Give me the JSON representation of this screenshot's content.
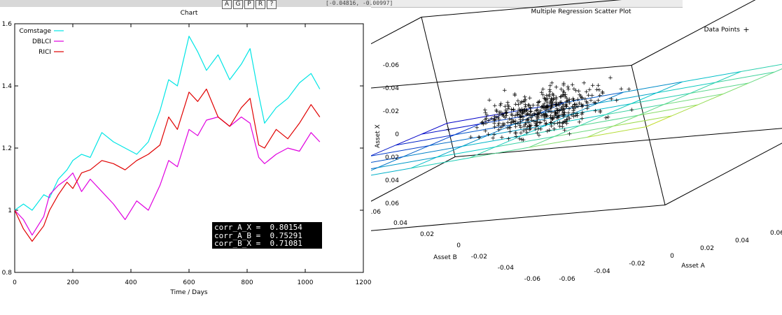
{
  "toolbar": {
    "buttons": [
      "A",
      "G",
      "P",
      "R",
      "?"
    ],
    "coord_readout": "[-0.04816, -0.00997]"
  },
  "left_panel": {
    "title": "Chart",
    "correlations": [
      {
        "label": "corr_A_X",
        "value": "0.80154"
      },
      {
        "label": "corr_A_B",
        "value": "0.75291"
      },
      {
        "label": "corr_B_X",
        "value": "0.71081"
      }
    ]
  },
  "right_panel": {
    "title": "Multiple Regression Scatter Plot"
  },
  "chart_data": [
    {
      "type": "line",
      "title": "Chart",
      "xlabel": "Time / Days",
      "ylabel": "",
      "xlim": [
        0,
        1200
      ],
      "ylim": [
        0.8,
        1.6
      ],
      "xticks": [
        "0",
        "200",
        "400",
        "600",
        "800",
        "1000",
        "1200"
      ],
      "yticks": [
        "0.8",
        "1",
        "1.2",
        "1.4",
        "1.6"
      ],
      "legend_position": "top-left",
      "grid": false,
      "series": [
        {
          "name": "Comstage",
          "color": "#00e5e5",
          "x": [
            0,
            30,
            60,
            100,
            120,
            150,
            180,
            200,
            230,
            260,
            300,
            340,
            380,
            420,
            460,
            500,
            530,
            560,
            600,
            630,
            660,
            700,
            740,
            780,
            810,
            840,
            860,
            900,
            940,
            980,
            1020,
            1050
          ],
          "y": [
            1.0,
            1.02,
            1.0,
            1.05,
            1.04,
            1.1,
            1.13,
            1.16,
            1.18,
            1.17,
            1.25,
            1.22,
            1.2,
            1.18,
            1.22,
            1.32,
            1.42,
            1.4,
            1.56,
            1.51,
            1.45,
            1.5,
            1.42,
            1.47,
            1.52,
            1.37,
            1.28,
            1.33,
            1.36,
            1.41,
            1.44,
            1.39
          ]
        },
        {
          "name": "DBLCI",
          "color": "#e000e0",
          "x": [
            0,
            30,
            60,
            100,
            120,
            150,
            180,
            200,
            230,
            260,
            300,
            340,
            380,
            420,
            460,
            500,
            530,
            560,
            600,
            630,
            660,
            700,
            740,
            780,
            810,
            840,
            860,
            900,
            940,
            980,
            1020,
            1050
          ],
          "y": [
            1.0,
            0.97,
            0.92,
            0.98,
            1.05,
            1.08,
            1.1,
            1.12,
            1.06,
            1.1,
            1.06,
            1.02,
            0.97,
            1.03,
            1.0,
            1.08,
            1.16,
            1.14,
            1.26,
            1.24,
            1.29,
            1.3,
            1.27,
            1.3,
            1.28,
            1.17,
            1.15,
            1.18,
            1.2,
            1.19,
            1.25,
            1.22
          ]
        },
        {
          "name": "RICI",
          "color": "#e00000",
          "x": [
            0,
            30,
            60,
            100,
            120,
            150,
            180,
            200,
            230,
            260,
            300,
            340,
            380,
            420,
            460,
            500,
            530,
            560,
            600,
            630,
            660,
            700,
            740,
            780,
            810,
            840,
            860,
            900,
            940,
            980,
            1020,
            1050
          ],
          "y": [
            1.0,
            0.94,
            0.9,
            0.95,
            1.0,
            1.05,
            1.09,
            1.07,
            1.12,
            1.13,
            1.16,
            1.15,
            1.13,
            1.16,
            1.18,
            1.21,
            1.3,
            1.26,
            1.38,
            1.35,
            1.39,
            1.3,
            1.27,
            1.33,
            1.36,
            1.21,
            1.2,
            1.26,
            1.23,
            1.28,
            1.34,
            1.3
          ]
        }
      ]
    },
    {
      "type": "scatter",
      "title": "Multiple Regression Scatter Plot",
      "xlabel": "Asset A",
      "ylabel": "Asset B",
      "zlabel": "Asset X",
      "xlim": [
        -0.06,
        0.06
      ],
      "ylim": [
        -0.06,
        0.06
      ],
      "zlim": [
        -0.06,
        0.06
      ],
      "xticks": [
        "-0.06",
        "-0.04",
        "-0.02",
        "0",
        "0.02",
        "0.04",
        "0.06"
      ],
      "yticks": [
        "-0.06",
        "-0.04",
        "-0.02",
        "0",
        "0.02",
        "0.04",
        "0.06"
      ],
      "zticks": [
        "-0.06",
        "-0.04",
        "-0.02",
        "0",
        "0.02",
        "0.04",
        "0.06"
      ],
      "legend_position": "top-right",
      "series": [
        {
          "name": "Data Points",
          "color": "#0000c0",
          "marker": "+"
        }
      ],
      "regression_plane": {
        "z_at": [
          [
            -0.06,
            -0.06,
            -0.035
          ],
          [
            0.06,
            -0.06,
            0.02
          ],
          [
            0.06,
            0.06,
            0.045
          ],
          [
            -0.06,
            0.06,
            -0.005
          ]
        ]
      }
    }
  ]
}
